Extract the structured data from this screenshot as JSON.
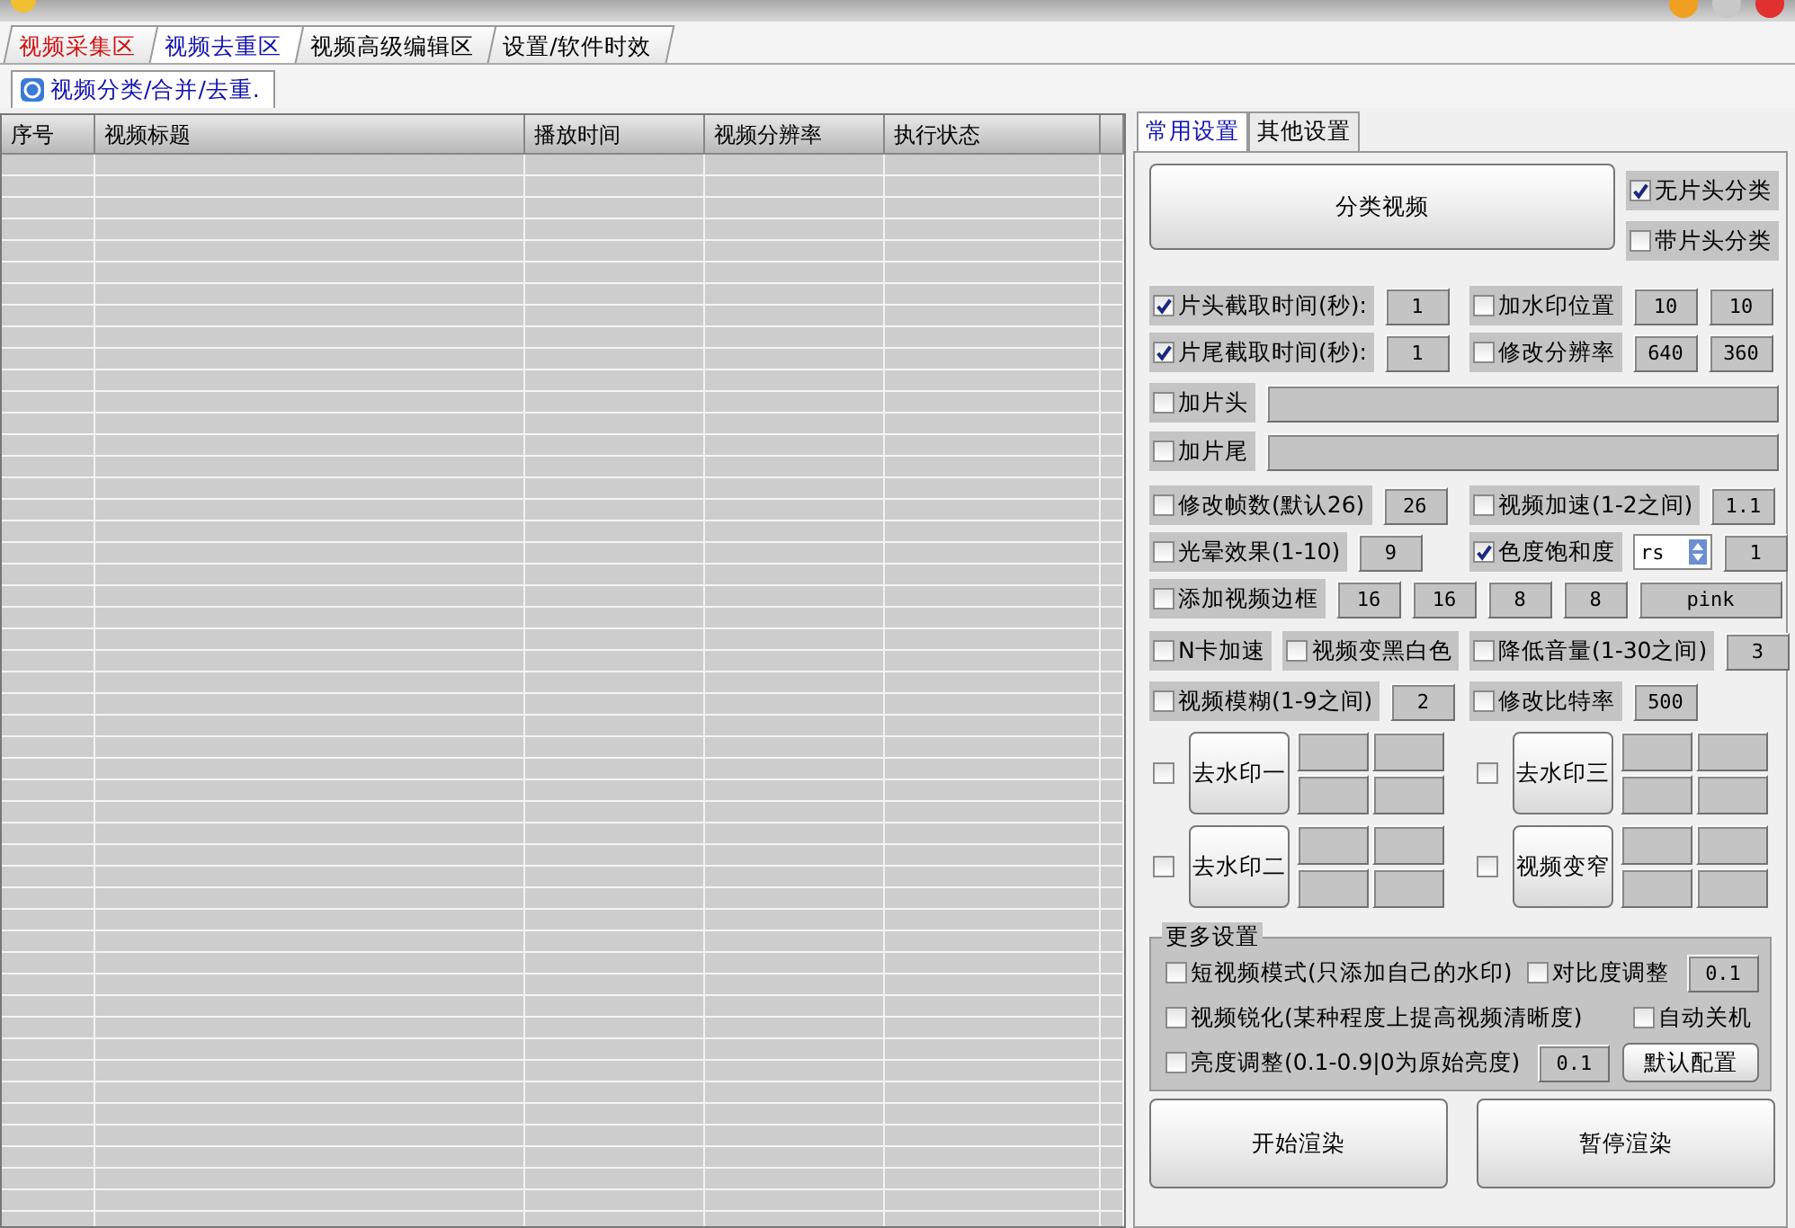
{
  "tabs": [
    {
      "label": "视频采集区",
      "selected": false,
      "highlight": true
    },
    {
      "label": "视频去重区",
      "selected": true,
      "highlight": false
    },
    {
      "label": "视频高级编辑区",
      "selected": false,
      "highlight": false
    },
    {
      "label": "设置/软件时效",
      "selected": false,
      "highlight": false
    }
  ],
  "subtabs": [
    {
      "label": "视频分类/合并/去重.",
      "selected": true
    }
  ],
  "table": {
    "columns": [
      "序号",
      "视频标题",
      "播放时间",
      "视频分辨率",
      "执行状态"
    ]
  },
  "settings": {
    "tabs": [
      {
        "label": "常用设置",
        "selected": true
      },
      {
        "label": "其他设置",
        "selected": false
      }
    ],
    "classify_button": "分类视频",
    "classify_options": [
      {
        "label": "无片头分类",
        "checked": true
      },
      {
        "label": "带片头分类",
        "checked": false
      }
    ],
    "rows": [
      [
        [
          {
            "kind": "check",
            "label": "片头截取时间(秒):",
            "checked": true
          },
          {
            "kind": "field",
            "value": "1"
          }
        ],
        [
          {
            "kind": "check",
            "label": "加水印位置",
            "checked": false
          },
          {
            "kind": "field",
            "value": "10"
          },
          {
            "kind": "field",
            "value": "10"
          }
        ]
      ],
      [
        [
          {
            "kind": "check",
            "label": "片尾截取时间(秒):",
            "checked": true
          },
          {
            "kind": "field",
            "value": "1"
          }
        ],
        [
          {
            "kind": "check",
            "label": "修改分辨率",
            "checked": false
          },
          {
            "kind": "field",
            "value": "640"
          },
          {
            "kind": "field",
            "value": "360"
          }
        ]
      ],
      [
        [
          {
            "kind": "check",
            "label": "加片头",
            "checked": false
          },
          {
            "kind": "wide"
          }
        ]
      ],
      [
        [
          {
            "kind": "check",
            "label": "加片尾",
            "checked": false
          },
          {
            "kind": "wide"
          }
        ]
      ],
      [
        [
          {
            "kind": "check",
            "label": "修改帧数(默认26)",
            "checked": false
          },
          {
            "kind": "field",
            "value": "26"
          }
        ],
        [
          {
            "kind": "check",
            "label": "视频加速(1-2之间)",
            "checked": false
          },
          {
            "kind": "field",
            "value": "1.1"
          }
        ]
      ],
      [
        [
          {
            "kind": "check",
            "label": "光晕效果(1-10)",
            "checked": false
          },
          {
            "kind": "field",
            "value": "9"
          }
        ],
        [
          {
            "kind": "check",
            "label": "色度饱和度",
            "checked": true
          },
          {
            "kind": "select",
            "value": "rs"
          },
          {
            "kind": "field",
            "value": "1"
          }
        ]
      ],
      [
        [
          {
            "kind": "check",
            "label": "添加视频边框",
            "checked": false
          },
          {
            "kind": "field",
            "value": "16"
          },
          {
            "kind": "field",
            "value": "16"
          },
          {
            "kind": "field",
            "value": "8"
          },
          {
            "kind": "field",
            "value": "8"
          },
          {
            "kind": "colorfield",
            "value": "pink"
          }
        ]
      ],
      [
        [
          {
            "kind": "check",
            "label": "N卡加速",
            "checked": false
          },
          {
            "kind": "check",
            "label": "视频变黑白色",
            "checked": false
          }
        ],
        [
          {
            "kind": "check",
            "label": "降低音量(1-30之间)",
            "checked": false
          },
          {
            "kind": "field",
            "value": "3"
          }
        ]
      ],
      [
        [
          {
            "kind": "check",
            "label": "视频模糊(1-9之间)",
            "checked": false
          },
          {
            "kind": "field",
            "value": "2"
          }
        ],
        [
          {
            "kind": "check",
            "label": "修改比特率",
            "checked": false
          },
          {
            "kind": "field",
            "value": "500"
          }
        ]
      ]
    ],
    "watermarks": [
      {
        "label": "去水印一",
        "checked": false
      },
      {
        "label": "去水印三",
        "checked": false
      },
      {
        "label": "去水印二",
        "checked": false
      },
      {
        "label": "视频变窄",
        "checked": false
      }
    ],
    "more": {
      "title": "更多设置",
      "short_mode": {
        "label": "短视频模式(只添加自己的水印)",
        "checked": false
      },
      "contrast": {
        "label": "对比度调整",
        "checked": false,
        "value": "0.1"
      },
      "sharpen": {
        "label": "视频锐化(某种程度上提高视频清晰度)",
        "checked": false
      },
      "shutdown": {
        "label": "自动关机",
        "checked": false
      },
      "brightness": {
        "label": "亮度调整(0.1-0.9|0为原始亮度)",
        "checked": false,
        "value": "0.1"
      },
      "default_button": "默认配置"
    },
    "actions": [
      "开始渲染",
      "暂停渲染"
    ]
  }
}
